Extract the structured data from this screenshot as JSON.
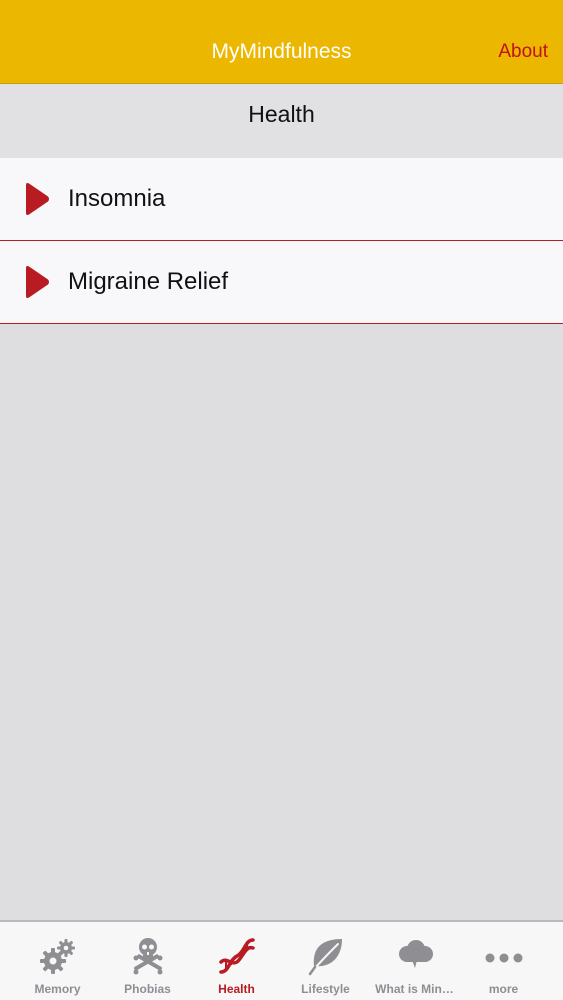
{
  "navbar": {
    "title": "MyMindfulness",
    "about_label": "About"
  },
  "section": {
    "title": "Health"
  },
  "items": [
    {
      "label": "Insomnia",
      "icon": "play-icon"
    },
    {
      "label": "Migraine Relief",
      "icon": "play-icon"
    }
  ],
  "tabs": [
    {
      "label": "Memory",
      "icon": "gears-icon",
      "active": false
    },
    {
      "label": "Phobias",
      "icon": "skull-icon",
      "active": false
    },
    {
      "label": "Health",
      "icon": "dna-icon",
      "active": true
    },
    {
      "label": "Lifestyle",
      "icon": "leaf-icon",
      "active": false
    },
    {
      "label": "What is Min…",
      "icon": "cloud-icon",
      "active": false
    },
    {
      "label": "more",
      "icon": "more-icon",
      "active": false
    }
  ],
  "colors": {
    "navbar": "#ebb700",
    "accent": "#b81b22",
    "tab_inactive": "#8e8e93"
  }
}
